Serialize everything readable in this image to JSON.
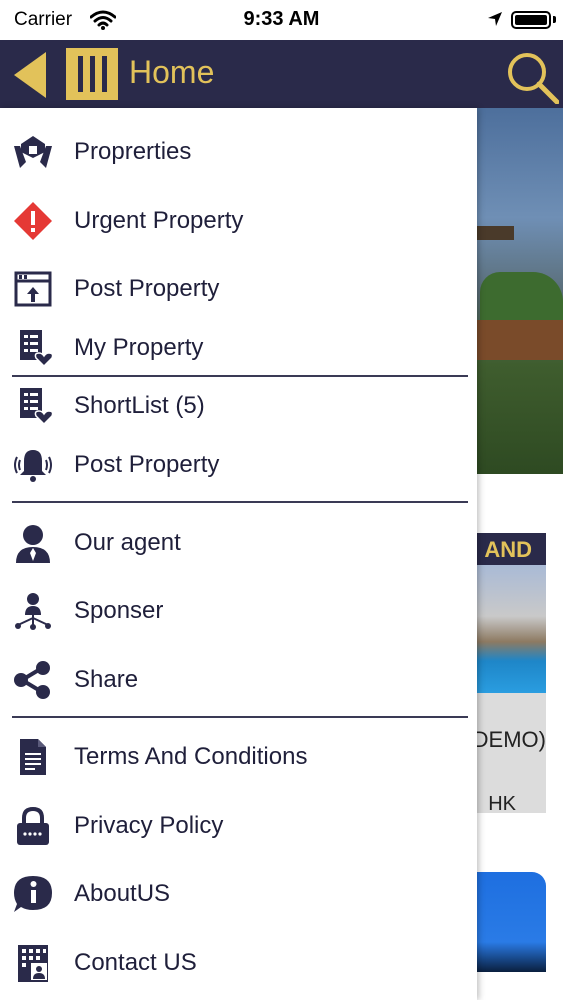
{
  "status": {
    "carrier": "Carrier",
    "time": "9:33 AM"
  },
  "header": {
    "title": "Home"
  },
  "background": {
    "band_text": "AND",
    "text1": "DEMO)",
    "text2": "HK"
  },
  "menu": {
    "items": [
      {
        "label": "Proprerties",
        "icon": "hands-house-icon"
      },
      {
        "label": "Urgent Property",
        "icon": "alert-diamond-icon"
      },
      {
        "label": "Post Property",
        "icon": "upload-window-icon"
      },
      {
        "label": "My Property",
        "icon": "list-heart-icon"
      },
      {
        "label": "ShortList (5)",
        "icon": "list-heart-icon"
      },
      {
        "label": "Post Property",
        "icon": "bell-ringing-icon"
      },
      {
        "label": "Our agent",
        "icon": "agent-icon"
      },
      {
        "label": "Sponser",
        "icon": "sponsor-network-icon"
      },
      {
        "label": "Share",
        "icon": "share-icon"
      },
      {
        "label": "Terms And Conditions",
        "icon": "document-icon"
      },
      {
        "label": "Privacy Policy",
        "icon": "lock-icon"
      },
      {
        "label": "AboutUS",
        "icon": "info-icon"
      },
      {
        "label": "Contact US",
        "icon": "contact-building-icon"
      }
    ]
  },
  "colors": {
    "header_bg": "#2a2a4a",
    "accent_gold": "#e2c25a",
    "icon_dark": "#2a2a4a",
    "alert_red": "#e53935"
  }
}
